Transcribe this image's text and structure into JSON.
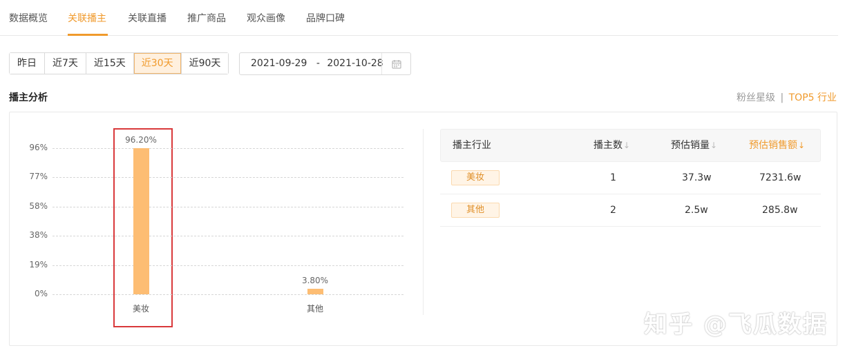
{
  "tabs": [
    "数据概览",
    "关联播主",
    "关联直播",
    "推广商品",
    "观众画像",
    "品牌口碑"
  ],
  "active_tab": "关联播主",
  "date_ranges": [
    "昨日",
    "近7天",
    "近15天",
    "近30天",
    "近90天"
  ],
  "active_range": "近30天",
  "date_picker": {
    "start": "2021-09-29",
    "separator": "-",
    "end": "2021-10-28"
  },
  "section_title": "播主分析",
  "legend_links": {
    "fans": "粉丝星级",
    "divider": "|",
    "top5": "TOP5 行业"
  },
  "chart_data": {
    "type": "bar",
    "categories": [
      "美妆",
      "其他"
    ],
    "values": [
      96.2,
      3.8
    ],
    "value_labels": [
      "96.20%",
      "3.80%"
    ],
    "y_ticks": [
      "96%",
      "77%",
      "58%",
      "38%",
      "19%",
      "0%"
    ],
    "ylim": [
      0,
      96
    ],
    "bar_color": "#fdbd73",
    "grid": true
  },
  "table": {
    "headers": {
      "industry": "播主行业",
      "count": "播主数",
      "sales": "预估销量",
      "amount": "预估销售额"
    },
    "sorted_column": "amount",
    "rows": [
      {
        "industry": "美妆",
        "count": "1",
        "sales": "37.3w",
        "amount": "7231.6w"
      },
      {
        "industry": "其他",
        "count": "2",
        "sales": "2.5w",
        "amount": "285.8w"
      }
    ]
  },
  "watermark": "知乎 @飞瓜数据",
  "colors": {
    "accent": "#f09a2c",
    "highlight_box": "#d9383a",
    "bar": "#fdbd73"
  }
}
